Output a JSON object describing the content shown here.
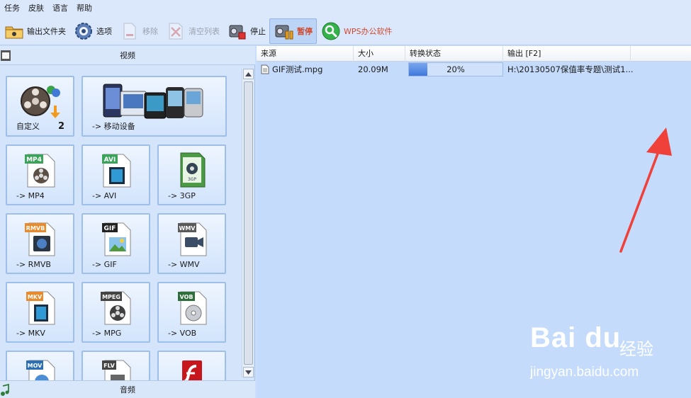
{
  "menu": [
    "任务",
    "皮肤",
    "语言",
    "帮助"
  ],
  "toolbar": [
    {
      "label": "输出文件夹",
      "icon": "folder-icon",
      "state": "normal"
    },
    {
      "label": "选项",
      "icon": "gear-icon",
      "state": "normal"
    },
    {
      "label": "移除",
      "icon": "document-remove-icon",
      "state": "disabled"
    },
    {
      "label": "清空列表",
      "icon": "clear-list-icon",
      "state": "disabled"
    },
    {
      "label": "停止",
      "icon": "stop-icon",
      "state": "normal"
    },
    {
      "label": "暂停",
      "icon": "pause-icon",
      "state": "active"
    },
    {
      "label": "WPS办公软件",
      "icon": "wps-icon",
      "state": "normal"
    }
  ],
  "left_panel": {
    "video_header": "视频",
    "audio_header": "音频",
    "tiles": [
      {
        "label": "自定义",
        "badge": "2",
        "icon": "film-reel-icon"
      },
      {
        "label": "-> 移动设备",
        "icon": "mobile-devices-icon"
      },
      {
        "label": "-> MP4",
        "tag": "MP4",
        "icon": "mp4-file-icon"
      },
      {
        "label": "-> AVI",
        "tag": "AVI",
        "icon": "avi-file-icon"
      },
      {
        "label": "-> 3GP",
        "tag": "3GP",
        "icon": "3gp-file-icon"
      },
      {
        "label": "-> RMVB",
        "tag": "RMVB",
        "icon": "rmvb-file-icon"
      },
      {
        "label": "-> GIF",
        "tag": "GIF",
        "icon": "gif-file-icon"
      },
      {
        "label": "-> WMV",
        "tag": "WMV",
        "icon": "wmv-file-icon"
      },
      {
        "label": "-> MKV",
        "tag": "MKV",
        "icon": "mkv-file-icon"
      },
      {
        "label": "-> MPG",
        "tag": "MPEG",
        "icon": "mpg-file-icon"
      },
      {
        "label": "-> VOB",
        "tag": "VOB",
        "icon": "vob-file-icon"
      },
      {
        "label": "",
        "tag": "MOV",
        "icon": "mov-file-icon"
      },
      {
        "label": "",
        "tag": "FLV",
        "icon": "flv-file-icon"
      },
      {
        "label": "",
        "tag": "",
        "icon": "swf-file-icon"
      }
    ]
  },
  "file_list": {
    "columns": [
      "来源",
      "大小",
      "转换状态",
      "输出 [F2]"
    ],
    "rows": [
      {
        "source": "GIF测试.mpg",
        "size": "20.09M",
        "progress": 20,
        "progress_text": "20%",
        "output": "H:\\20130507保值率专题\\测试1..."
      }
    ]
  },
  "colors": {
    "accent_red": "#d0492d",
    "progress_blue": "#3f78dc",
    "arrow_red": "#f0403a"
  },
  "watermark": {
    "logo": "Bai du",
    "cn": "经验",
    "url": "jingyan.baidu.com"
  }
}
